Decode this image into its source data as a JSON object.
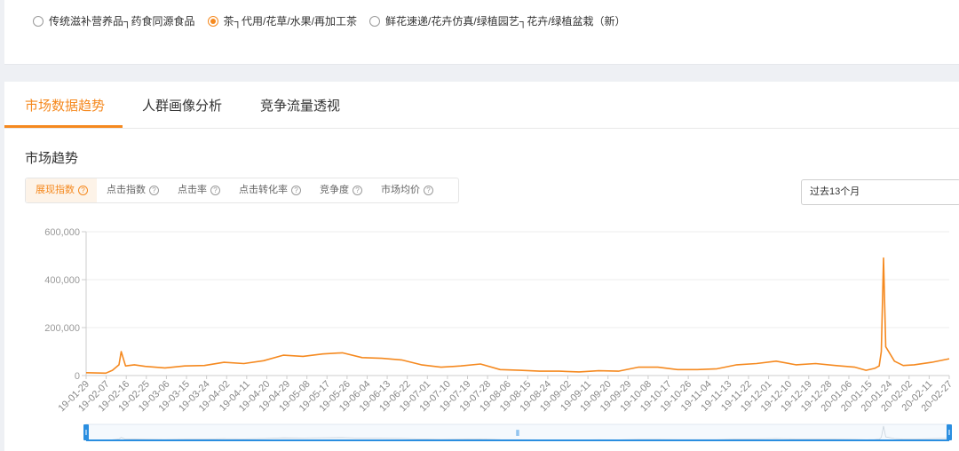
{
  "category_options": [
    {
      "label": "传统滋补营养品┐药食同源食品",
      "selected": false
    },
    {
      "label": "茶┐代用/花草/水果/再加工茶",
      "selected": true
    },
    {
      "label": "鲜花速递/花卉仿真/绿植园艺┐花卉/绿植盆栽（新）",
      "selected": false
    }
  ],
  "tabs": [
    {
      "label": "市场数据趋势",
      "active": true
    },
    {
      "label": "人群画像分析",
      "active": false
    },
    {
      "label": "竞争流量透视",
      "active": false
    }
  ],
  "section_title": "市场趋势",
  "metrics": [
    {
      "label": "展现指数",
      "active": true
    },
    {
      "label": "点击指数",
      "active": false
    },
    {
      "label": "点击率",
      "active": false
    },
    {
      "label": "点击转化率",
      "active": false
    },
    {
      "label": "竞争度",
      "active": false
    },
    {
      "label": "市场均价",
      "active": false
    }
  ],
  "help_icon": "question-circle-icon",
  "period_select": {
    "value": "过去13个月"
  },
  "colors": {
    "accent": "#f5891f",
    "line": "#f5891f",
    "grid": "#eeeeee",
    "slider": "#2a8ee0"
  },
  "chart_data": {
    "type": "line",
    "title": "",
    "xlabel": "",
    "ylabel": "",
    "ylim": [
      0,
      600000
    ],
    "y_ticks": [
      "0",
      "200,000",
      "400,000",
      "600,000"
    ],
    "x_tick_labels": [
      "19-01-29",
      "19-02-07",
      "19-02-16",
      "19-02-25",
      "19-03-06",
      "19-03-15",
      "19-03-24",
      "19-04-02",
      "19-04-11",
      "19-04-20",
      "19-04-29",
      "19-05-08",
      "19-05-17",
      "19-05-26",
      "19-06-04",
      "19-06-13",
      "19-06-22",
      "19-07-01",
      "19-07-10",
      "19-07-19",
      "19-07-28",
      "19-08-06",
      "19-08-15",
      "19-08-24",
      "19-09-02",
      "19-09-11",
      "19-09-20",
      "19-09-29",
      "19-10-08",
      "19-10-17",
      "19-10-26",
      "19-11-04",
      "19-11-13",
      "19-11-22",
      "19-12-01",
      "19-12-10",
      "19-12-19",
      "19-12-28",
      "20-01-06",
      "20-01-15",
      "20-01-24",
      "20-02-02",
      "20-02-11",
      "20-02-27"
    ],
    "series": [
      {
        "x": [
          "19-01-29",
          "19-02-07",
          "19-02-10",
          "19-02-13",
          "19-02-14",
          "19-02-16",
          "19-02-20",
          "19-02-25",
          "19-03-06",
          "19-03-15",
          "19-03-24",
          "19-04-02",
          "19-04-11",
          "19-04-20",
          "19-04-29",
          "19-05-08",
          "19-05-17",
          "19-05-26",
          "19-06-04",
          "19-06-13",
          "19-06-22",
          "19-07-01",
          "19-07-10",
          "19-07-19",
          "19-07-28",
          "19-08-06",
          "19-08-15",
          "19-08-24",
          "19-09-02",
          "19-09-11",
          "19-09-20",
          "19-09-29",
          "19-10-08",
          "19-10-17",
          "19-10-26",
          "19-11-04",
          "19-11-13",
          "19-11-22",
          "19-12-01",
          "19-12-10",
          "19-12-19",
          "19-12-28",
          "20-01-06",
          "20-01-15",
          "20-01-20",
          "20-01-24",
          "20-01-26",
          "20-01-27",
          "20-01-28",
          "20-01-29",
          "20-02-02",
          "20-02-06",
          "20-02-11",
          "20-02-19",
          "20-02-27"
        ],
        "values": [
          12000,
          10000,
          22000,
          45000,
          100000,
          40000,
          45000,
          38000,
          32000,
          40000,
          42000,
          55000,
          50000,
          62000,
          85000,
          80000,
          90000,
          95000,
          75000,
          72000,
          65000,
          45000,
          35000,
          40000,
          48000,
          25000,
          22000,
          18000,
          18000,
          15000,
          20000,
          18000,
          35000,
          35000,
          25000,
          25000,
          28000,
          45000,
          50000,
          60000,
          45000,
          50000,
          42000,
          35000,
          22000,
          30000,
          40000,
          100000,
          490000,
          120000,
          60000,
          42000,
          45000,
          55000,
          70000
        ]
      }
    ]
  }
}
